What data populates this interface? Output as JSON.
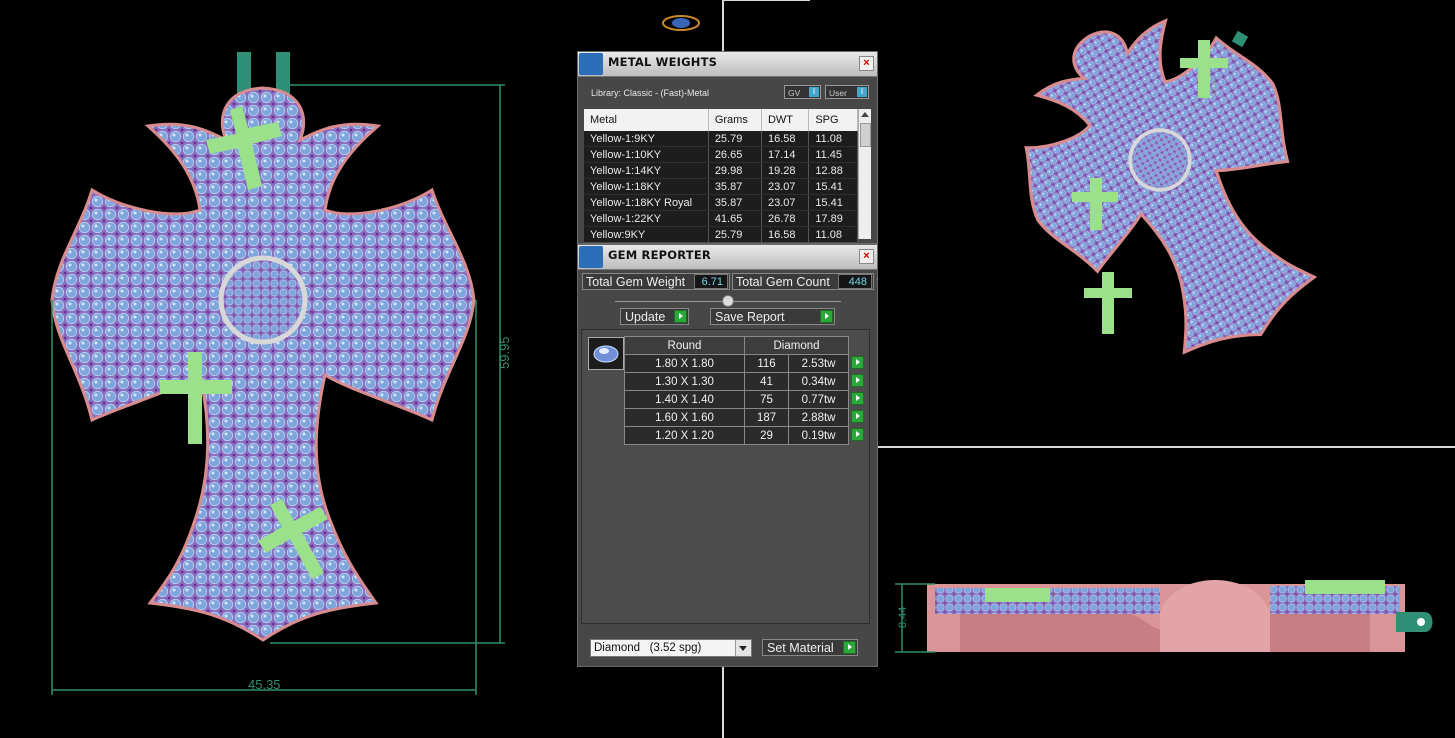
{
  "metal_weights": {
    "title": "METAL WEIGHTS",
    "library": "Library: Classic - (Fast)-Metal",
    "gv_label": "GV",
    "user_label": "User",
    "toggle_glyph": "I",
    "close_glyph": "×",
    "columns": [
      "Metal",
      "Grams",
      "DWT",
      "SPG"
    ],
    "rows": [
      [
        "Yellow-1:9KY",
        "25.79",
        "16.58",
        "11.08"
      ],
      [
        "Yellow-1:10KY",
        "26.65",
        "17.14",
        "11.45"
      ],
      [
        "Yellow-1:14KY",
        "29.98",
        "19.28",
        "12.88"
      ],
      [
        "Yellow-1:18KY",
        "35.87",
        "23.07",
        "15.41"
      ],
      [
        "Yellow-1:18KY Royal",
        "35.87",
        "23.07",
        "15.41"
      ],
      [
        "Yellow-1:22KY",
        "41.65",
        "26.78",
        "17.89"
      ],
      [
        "Yellow:9KY",
        "25.79",
        "16.58",
        "11.08"
      ]
    ]
  },
  "gem_reporter": {
    "title": "GEM REPORTER",
    "close_glyph": "×",
    "total_weight_label": "Total Gem Weight",
    "total_weight_value": "6.71",
    "total_count_label": "Total Gem Count",
    "total_count_value": "448",
    "update_label": "Update",
    "save_label": "Save Report",
    "table_headers": [
      "Round",
      "Diamond"
    ],
    "gems": [
      {
        "size": "1.80 X 1.80",
        "count": "116",
        "weight": "2.53tw"
      },
      {
        "size": "1.30 X 1.30",
        "count": "41",
        "weight": "0.34tw"
      },
      {
        "size": "1.40 X 1.40",
        "count": "75",
        "weight": "0.77tw"
      },
      {
        "size": "1.60 X 1.60",
        "count": "187",
        "weight": "2.88tw"
      },
      {
        "size": "1.20 X 1.20",
        "count": "29",
        "weight": "0.19tw"
      }
    ],
    "material_value": "Diamond   (3.52 spg)",
    "set_material_label": "Set Material"
  },
  "viewport": {
    "dim_width": "45.35",
    "dim_height": "59.95",
    "dim_side": "8.44"
  },
  "colors": {
    "metal": "#d98c8f",
    "gem": "#7aa0d8",
    "prong": "#7d3fa8",
    "cross_accent": "#9be08a",
    "dimension": "#2f8f6a"
  }
}
